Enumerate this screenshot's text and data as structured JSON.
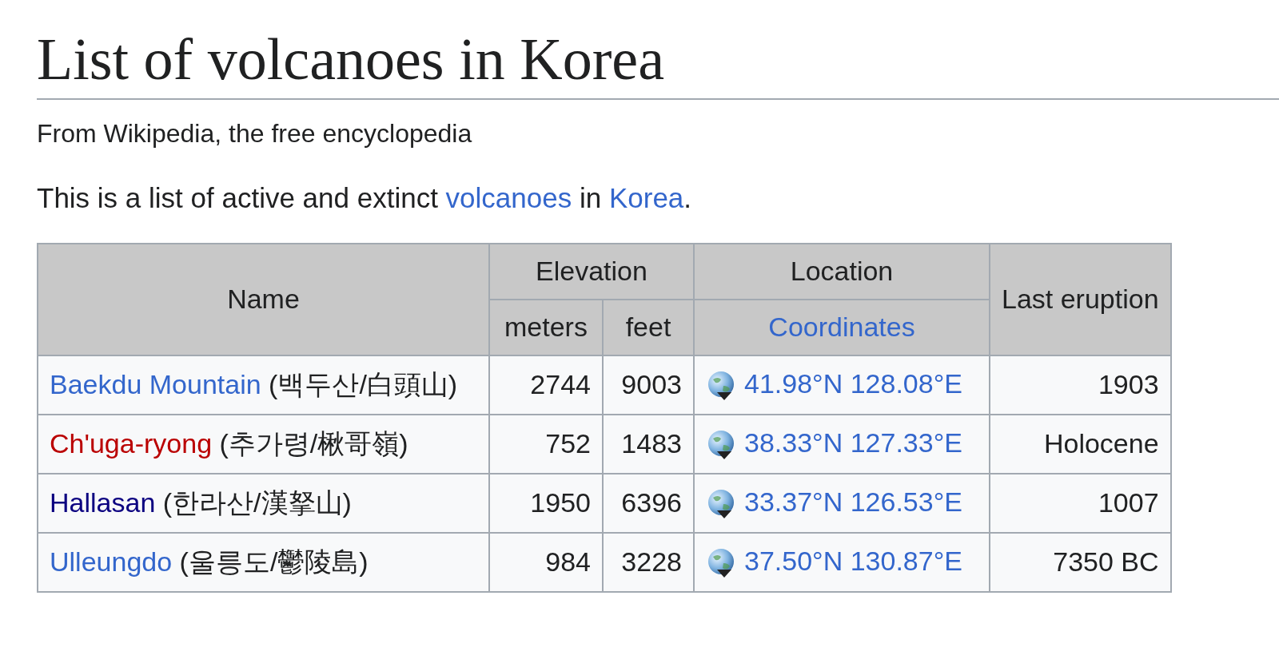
{
  "title": "List of volcanoes in Korea",
  "tagline": "From Wikipedia, the free encyclopedia",
  "intro": [
    {
      "text": "This is a list of active and extinct "
    },
    {
      "text": "volcanoes",
      "link": true
    },
    {
      "text": " in "
    },
    {
      "text": "Korea",
      "link": true
    },
    {
      "text": "."
    }
  ],
  "table": {
    "headers": {
      "name": "Name",
      "elevation": "Elevation",
      "location": "Location",
      "last_eruption": "Last eruption",
      "meters": "meters",
      "feet": "feet",
      "coordinates": "Coordinates"
    },
    "rows": [
      {
        "name": "Baekdu Mountain",
        "color": "#3366cc",
        "native": "(백두산/白頭山)",
        "meters": "2744",
        "feet": "9003",
        "coordinates": "41.98°N 128.08°E",
        "last_eruption": "1903"
      },
      {
        "name": "Ch'uga-ryong",
        "color": "#ba0000",
        "native": "(추가령/楸哥嶺)",
        "meters": "752",
        "feet": "1483",
        "coordinates": "38.33°N 127.33°E",
        "last_eruption": "Holocene"
      },
      {
        "name": "Hallasan",
        "color": "#0b0080",
        "native": "(한라산/漢拏山)",
        "meters": "1950",
        "feet": "6396",
        "coordinates": "33.37°N 126.53°E",
        "last_eruption": "1007"
      },
      {
        "name": "Ulleungdo",
        "color": "#3366cc",
        "native": "(울릉도/鬱陵島)",
        "meters": "984",
        "feet": "3228",
        "coordinates": "37.50°N 130.87°E",
        "last_eruption": "7350 BC"
      }
    ]
  }
}
